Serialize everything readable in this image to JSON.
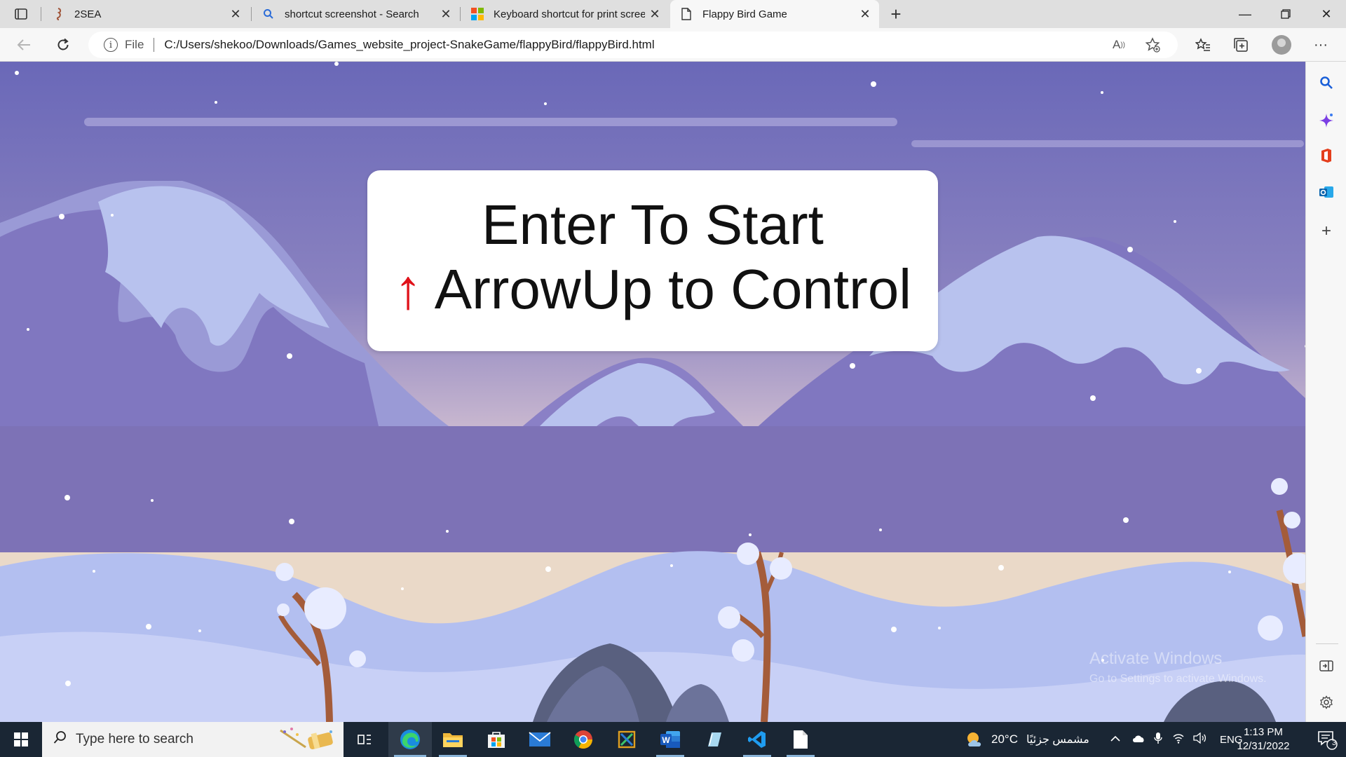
{
  "browser": {
    "tabs": [
      {
        "title": "2SEA",
        "icon": "seahorse-favicon-icon"
      },
      {
        "title": "shortcut screenshot - Search",
        "icon": "search-favicon-icon"
      },
      {
        "title": "Keyboard shortcut for print scree",
        "icon": "microsoft-logo-icon"
      },
      {
        "title": "Flappy Bird Game",
        "icon": "page-icon",
        "active": true
      }
    ],
    "address": {
      "scheme_label": "File",
      "url": "C:/Users/shekoo/Downloads/Games_website_project-SnakeGame/flappyBird/flappyBird.html"
    }
  },
  "game": {
    "line1": "Enter To Start",
    "arrow": "↑",
    "line2": "ArrowUp to Control"
  },
  "watermark": {
    "title": "Activate Windows",
    "subtitle": "Go to Settings to activate Windows."
  },
  "taskbar": {
    "search_placeholder": "Type here to search",
    "weather": {
      "temp": "20°C",
      "condition": "مشمس جزئيًا"
    },
    "language": "ENG",
    "time": "1:13 PM",
    "date": "12/31/2022",
    "notification_count": "3"
  },
  "colors": {
    "sky_top": "#6a68b8",
    "sky_glow": "#e8d8c8",
    "mountain_purple": "#8077c0",
    "snow": "#b8c2ee",
    "foreground": "#b3bff0",
    "arrow_red": "#e0121a",
    "taskbar": "#1a2634"
  }
}
